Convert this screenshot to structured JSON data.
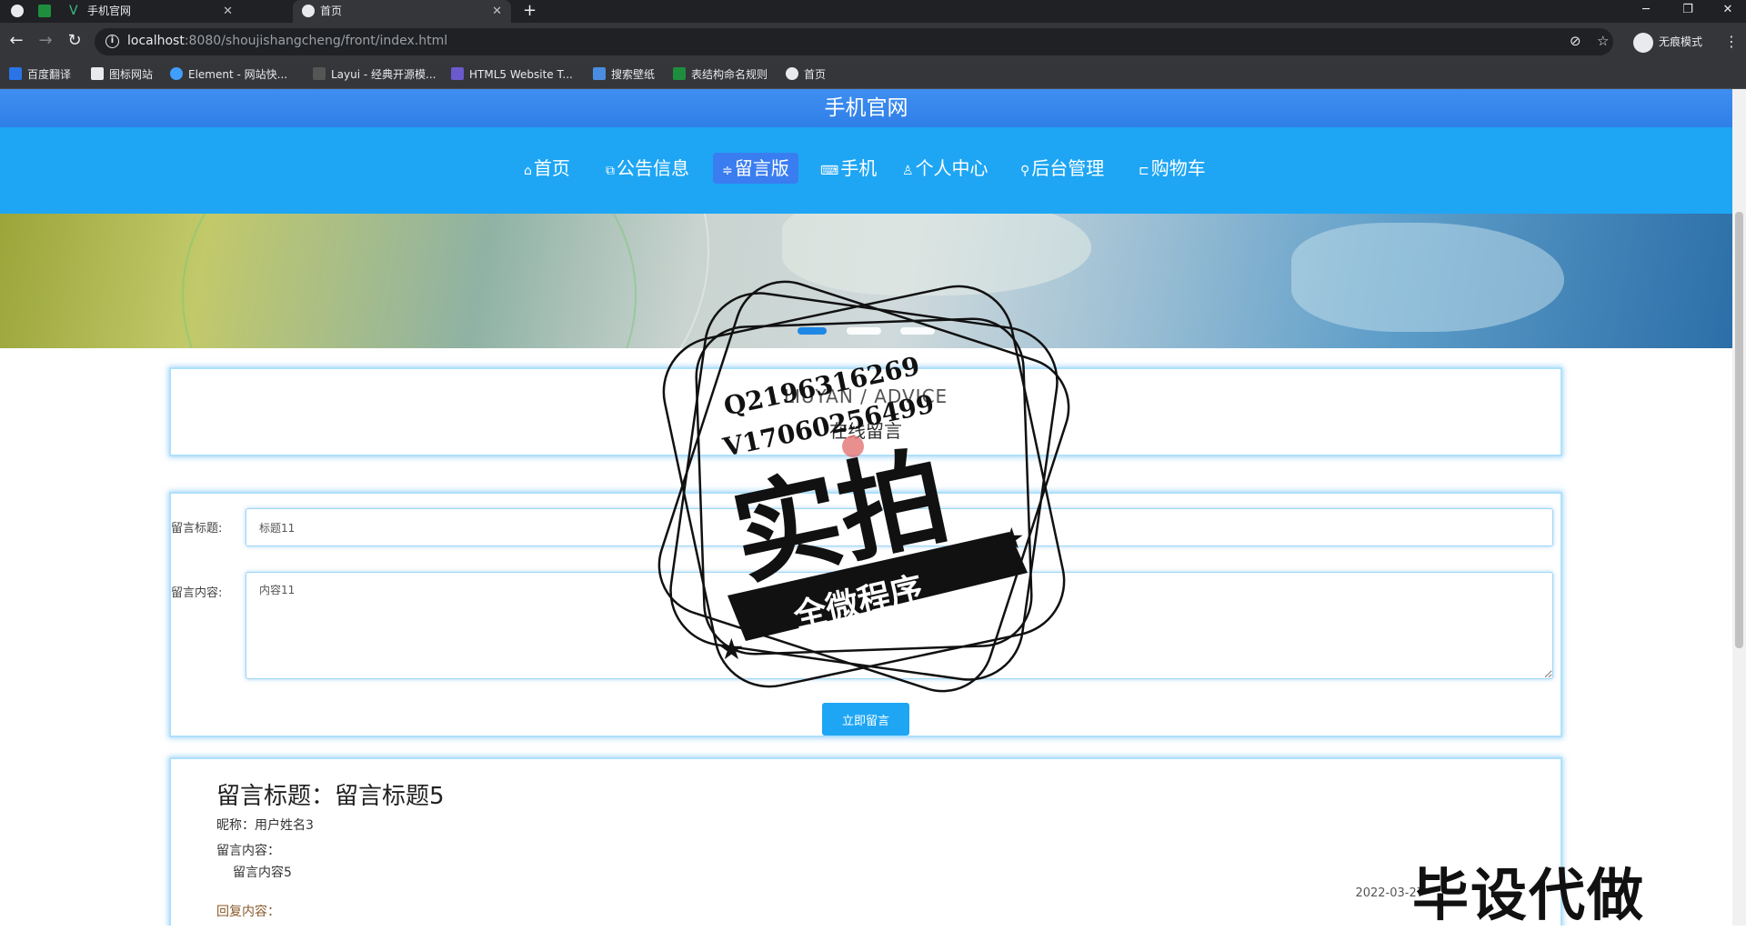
{
  "browser": {
    "tabs": [
      {
        "title": "手机官网"
      },
      {
        "title": "首页"
      }
    ],
    "url_host": "localhost",
    "url_rest": ":8080/shoujishangcheng/front/index.html",
    "incognito_label": "无痕模式",
    "bookmarks": [
      "百度翻译",
      "图标网站",
      "Element - 网站快...",
      "Layui - 经典开源模...",
      "HTML5 Website T...",
      "搜索壁纸",
      "表结构命名规则",
      "首页"
    ]
  },
  "site": {
    "title": "手机官网",
    "nav": [
      {
        "icon": "⌂",
        "label": "首页",
        "active": false
      },
      {
        "icon": "⧉",
        "label": "公告信息",
        "active": false
      },
      {
        "icon": "≑",
        "label": "留言版",
        "active": true
      },
      {
        "icon": "⌨",
        "label": "手机",
        "active": false
      },
      {
        "icon": "♙",
        "label": "个人中心",
        "active": false
      },
      {
        "icon": "⚲",
        "label": "后台管理",
        "active": false
      },
      {
        "icon": "⊏",
        "label": "购物车",
        "active": false
      }
    ]
  },
  "section": {
    "subtitle": "LIUYAN / ADVICE",
    "title": "在线留言"
  },
  "form": {
    "title_label": "留言标题:",
    "title_value": "标题11",
    "content_label": "留言内容:",
    "content_value": "内容11",
    "submit_label": "立即留言"
  },
  "message": {
    "title": "留言标题：留言标题5",
    "nickname": "昵称：用户姓名3",
    "content_label": "留言内容：",
    "content": "留言内容5",
    "reply_label": "回复内容：",
    "date": "2022-03-27"
  },
  "watermark": {
    "line1": "Q2196316269",
    "line2": "V17060256499",
    "big": "实拍",
    "ribbon": "全微程序",
    "corner": "毕设代做"
  },
  "colors": {
    "nav_bg": "#1ea6f4",
    "title_bar": "#3f8ef0",
    "nav_active": "#3a7df0"
  }
}
